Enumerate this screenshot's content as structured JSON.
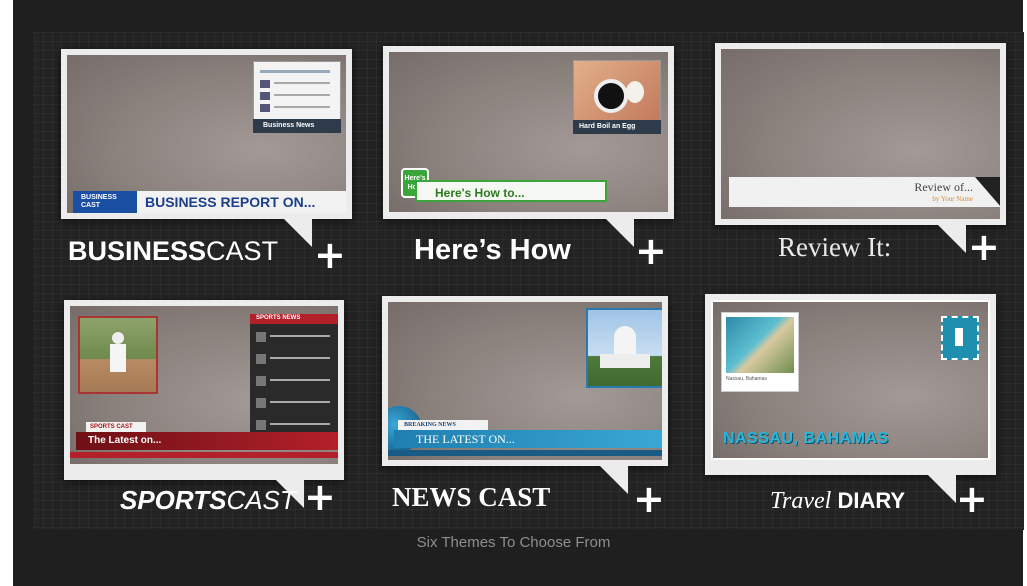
{
  "caption": "Six Themes To Choose From",
  "themes": [
    {
      "name_main": "BUSINESS",
      "name_rest": "CAST",
      "lower_third_logo_line1": "BUSINESS",
      "lower_third_logo_line2": "CAST",
      "lower_third_text": "BUSINESS REPORT ON...",
      "inset_label": "Business News"
    },
    {
      "name": "Here’s How",
      "badge_line1": "Here's",
      "badge_line2": "How",
      "lower_third_text": "Here's How to...",
      "inset_label": "Hard Boil an Egg"
    },
    {
      "name": "Review It:",
      "lower_third_text": "Review of...",
      "lower_third_sub": "by Your Name"
    },
    {
      "name_main": "SPORTS",
      "name_rest": "CAST",
      "side_panel_title": "SPORTS NEWS",
      "lower_third_tag": "SPORTS CAST",
      "lower_third_text": "The Latest on..."
    },
    {
      "name": "NEWS CAST",
      "lower_third_tag": "BREAKING NEWS",
      "lower_third_text": "THE LATEST ON..."
    },
    {
      "name_script": "Travel",
      "name_main": "DIARY",
      "place_text": "NASSAU, BAHAMAS",
      "inset_label": "Nassau, Bahamas"
    }
  ],
  "plus_symbol": "+"
}
